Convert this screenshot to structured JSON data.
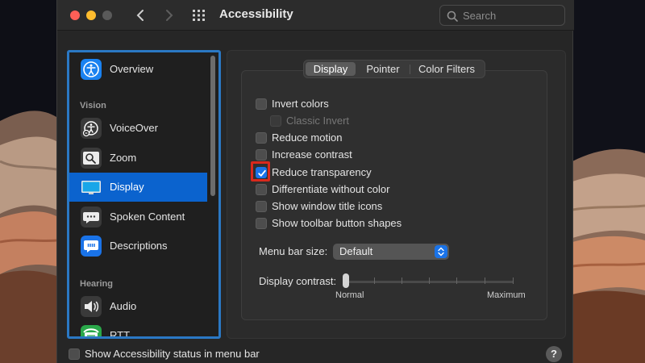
{
  "window": {
    "title": "Accessibility",
    "search_placeholder": "Search"
  },
  "sidebar": {
    "items": [
      {
        "label": "Overview",
        "icon": "accessibility-icon",
        "color": "#1a82f0"
      },
      {
        "label": "VoiceOver",
        "icon": "voiceover-icon",
        "color": "#3a3a3a"
      },
      {
        "label": "Zoom",
        "icon": "zoom-icon",
        "color": "#3a3a3a"
      },
      {
        "label": "Display",
        "icon": "display-icon",
        "color": "#16a3e6"
      },
      {
        "label": "Spoken Content",
        "icon": "speech-bubble-icon",
        "color": "#3a3a3a"
      },
      {
        "label": "Descriptions",
        "icon": "quote-bubble-icon",
        "color": "#1a73e8"
      },
      {
        "label": "Audio",
        "icon": "speaker-icon",
        "color": "#3a3a3a"
      },
      {
        "label": "RTT",
        "icon": "rtt-phone-icon",
        "color": "#2aa84a"
      }
    ],
    "sections": {
      "vision": "Vision",
      "hearing": "Hearing"
    },
    "selected": "Display"
  },
  "tabs": [
    "Display",
    "Pointer",
    "Color Filters"
  ],
  "active_tab": "Display",
  "options": [
    {
      "label": "Invert colors",
      "checked": false,
      "enabled": true
    },
    {
      "label": "Classic Invert",
      "checked": false,
      "enabled": false
    },
    {
      "label": "Reduce motion",
      "checked": false,
      "enabled": true
    },
    {
      "label": "Increase contrast",
      "checked": false,
      "enabled": true
    },
    {
      "label": "Reduce transparency",
      "checked": true,
      "enabled": true
    },
    {
      "label": "Differentiate without color",
      "checked": false,
      "enabled": true
    },
    {
      "label": "Show window title icons",
      "checked": false,
      "enabled": true
    },
    {
      "label": "Show toolbar button shapes",
      "checked": false,
      "enabled": true
    }
  ],
  "menu_bar_size": {
    "label": "Menu bar size:",
    "value": "Default"
  },
  "display_contrast": {
    "label": "Display contrast:",
    "min_label": "Normal",
    "max_label": "Maximum",
    "value": 0
  },
  "footer": {
    "status_label": "Show Accessibility status in menu bar",
    "status_checked": false,
    "help": "?"
  },
  "colors": {
    "accent": "#1a73e8",
    "selection": "#0b63ce",
    "highlight_box": "#d9291c",
    "sidebar_outline": "#2a78c4"
  }
}
